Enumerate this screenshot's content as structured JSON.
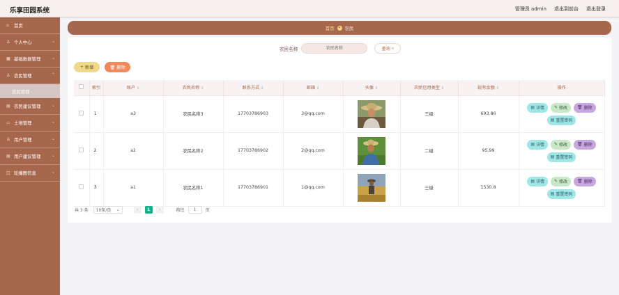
{
  "app": {
    "title": "乐享田园系统"
  },
  "header": {
    "user": "管理员 admin",
    "front": "退出到前台",
    "logout": "退出登录"
  },
  "sidebar": {
    "items": [
      {
        "label": "首页",
        "icon": "home-icon",
        "arrow": false
      },
      {
        "label": "个人中心",
        "icon": "user-icon",
        "arrow": true
      },
      {
        "label": "基础数据管理",
        "icon": "grid-icon",
        "arrow": true
      },
      {
        "label": "农民管理",
        "icon": "farmer-icon",
        "arrow": true
      }
    ],
    "sub_active": "农民管理",
    "items2": [
      {
        "label": "农民建议管理",
        "icon": "chat-icon",
        "arrow": true
      },
      {
        "label": "土地管理",
        "icon": "land-icon",
        "arrow": true
      },
      {
        "label": "用户管理",
        "icon": "users-icon",
        "arrow": true
      },
      {
        "label": "用户建议管理",
        "icon": "feedback-icon",
        "arrow": true
      },
      {
        "label": "轮播图信息",
        "icon": "image-icon",
        "arrow": true
      }
    ]
  },
  "breadcrumb": {
    "home": "首页",
    "current": "农民"
  },
  "search": {
    "label": "农民名称",
    "placeholder": "农民名称",
    "button": "查询"
  },
  "toolbar": {
    "add": "新增",
    "delete": "删除"
  },
  "table": {
    "headers": [
      "索引",
      "账户",
      "农民名称",
      "联系方式",
      "邮箱",
      "头像",
      "农民信用类型",
      "现有余额",
      "操作"
    ],
    "rows": [
      {
        "index": "1",
        "account": "a3",
        "name": "农民名称3",
        "phone": "17703786903",
        "email": "3@qq.com",
        "credit": "三级",
        "balance": "693.86"
      },
      {
        "index": "2",
        "account": "a2",
        "name": "农民名称2",
        "phone": "17703786902",
        "email": "2@qq.com",
        "credit": "二级",
        "balance": "95.99"
      },
      {
        "index": "3",
        "account": "a1",
        "name": "农民名称1",
        "phone": "17703786901",
        "email": "1@qq.com",
        "credit": "三级",
        "balance": "1530.8"
      }
    ],
    "ops": {
      "detail": "详情",
      "edit": "修改",
      "delete": "删除",
      "reset": "重置密码"
    }
  },
  "pagination": {
    "total": "共 3 条",
    "page_size": "10条/页",
    "prev": "‹",
    "current": "1",
    "next": "›",
    "goto_label": "前往",
    "goto_value": "1",
    "goto_suffix": "页"
  },
  "colors": {
    "brand": "#a7674c",
    "accent_green": "#16b08a"
  }
}
